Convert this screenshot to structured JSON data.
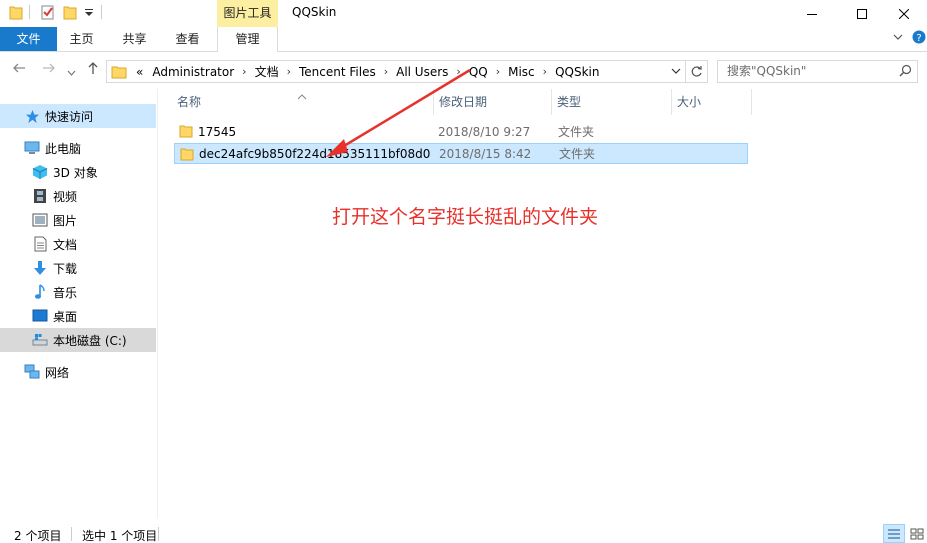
{
  "window": {
    "title": "QQSkin",
    "context_tab": "图片工具"
  },
  "ribbon": {
    "file": "文件",
    "home": "主页",
    "share": "共享",
    "view": "查看",
    "manage": "管理"
  },
  "address": {
    "breadcrumbs": [
      "Administrator",
      "文档",
      "Tencent Files",
      "All Users",
      "QQ",
      "Misc",
      "QQSkin"
    ],
    "overflow": "«"
  },
  "search": {
    "placeholder": "搜索\"QQSkin\""
  },
  "nav": {
    "quick_access": "快速访问",
    "this_pc": "此电脑",
    "objects3d": "3D 对象",
    "videos": "视频",
    "pictures": "图片",
    "documents": "文档",
    "downloads": "下载",
    "music": "音乐",
    "desktop": "桌面",
    "local_disk": "本地磁盘 (C:)",
    "network": "网络"
  },
  "columns": {
    "name": "名称",
    "date": "修改日期",
    "type": "类型",
    "size": "大小"
  },
  "files": [
    {
      "name": "17545",
      "date": "2018/8/10 9:27",
      "type": "文件夹"
    },
    {
      "name": "dec24afc9b850f224d18535111bf08d0",
      "date": "2018/8/15 8:42",
      "type": "文件夹"
    }
  ],
  "annotation": "打开这个名字挺长挺乱的文件夹",
  "status": {
    "count": "2 个项目",
    "selected": "选中 1 个项目"
  },
  "colors": {
    "accent": "#1979ca",
    "selection": "#cce8ff",
    "annotation": "#e8312b",
    "folder": "#ffd766"
  }
}
